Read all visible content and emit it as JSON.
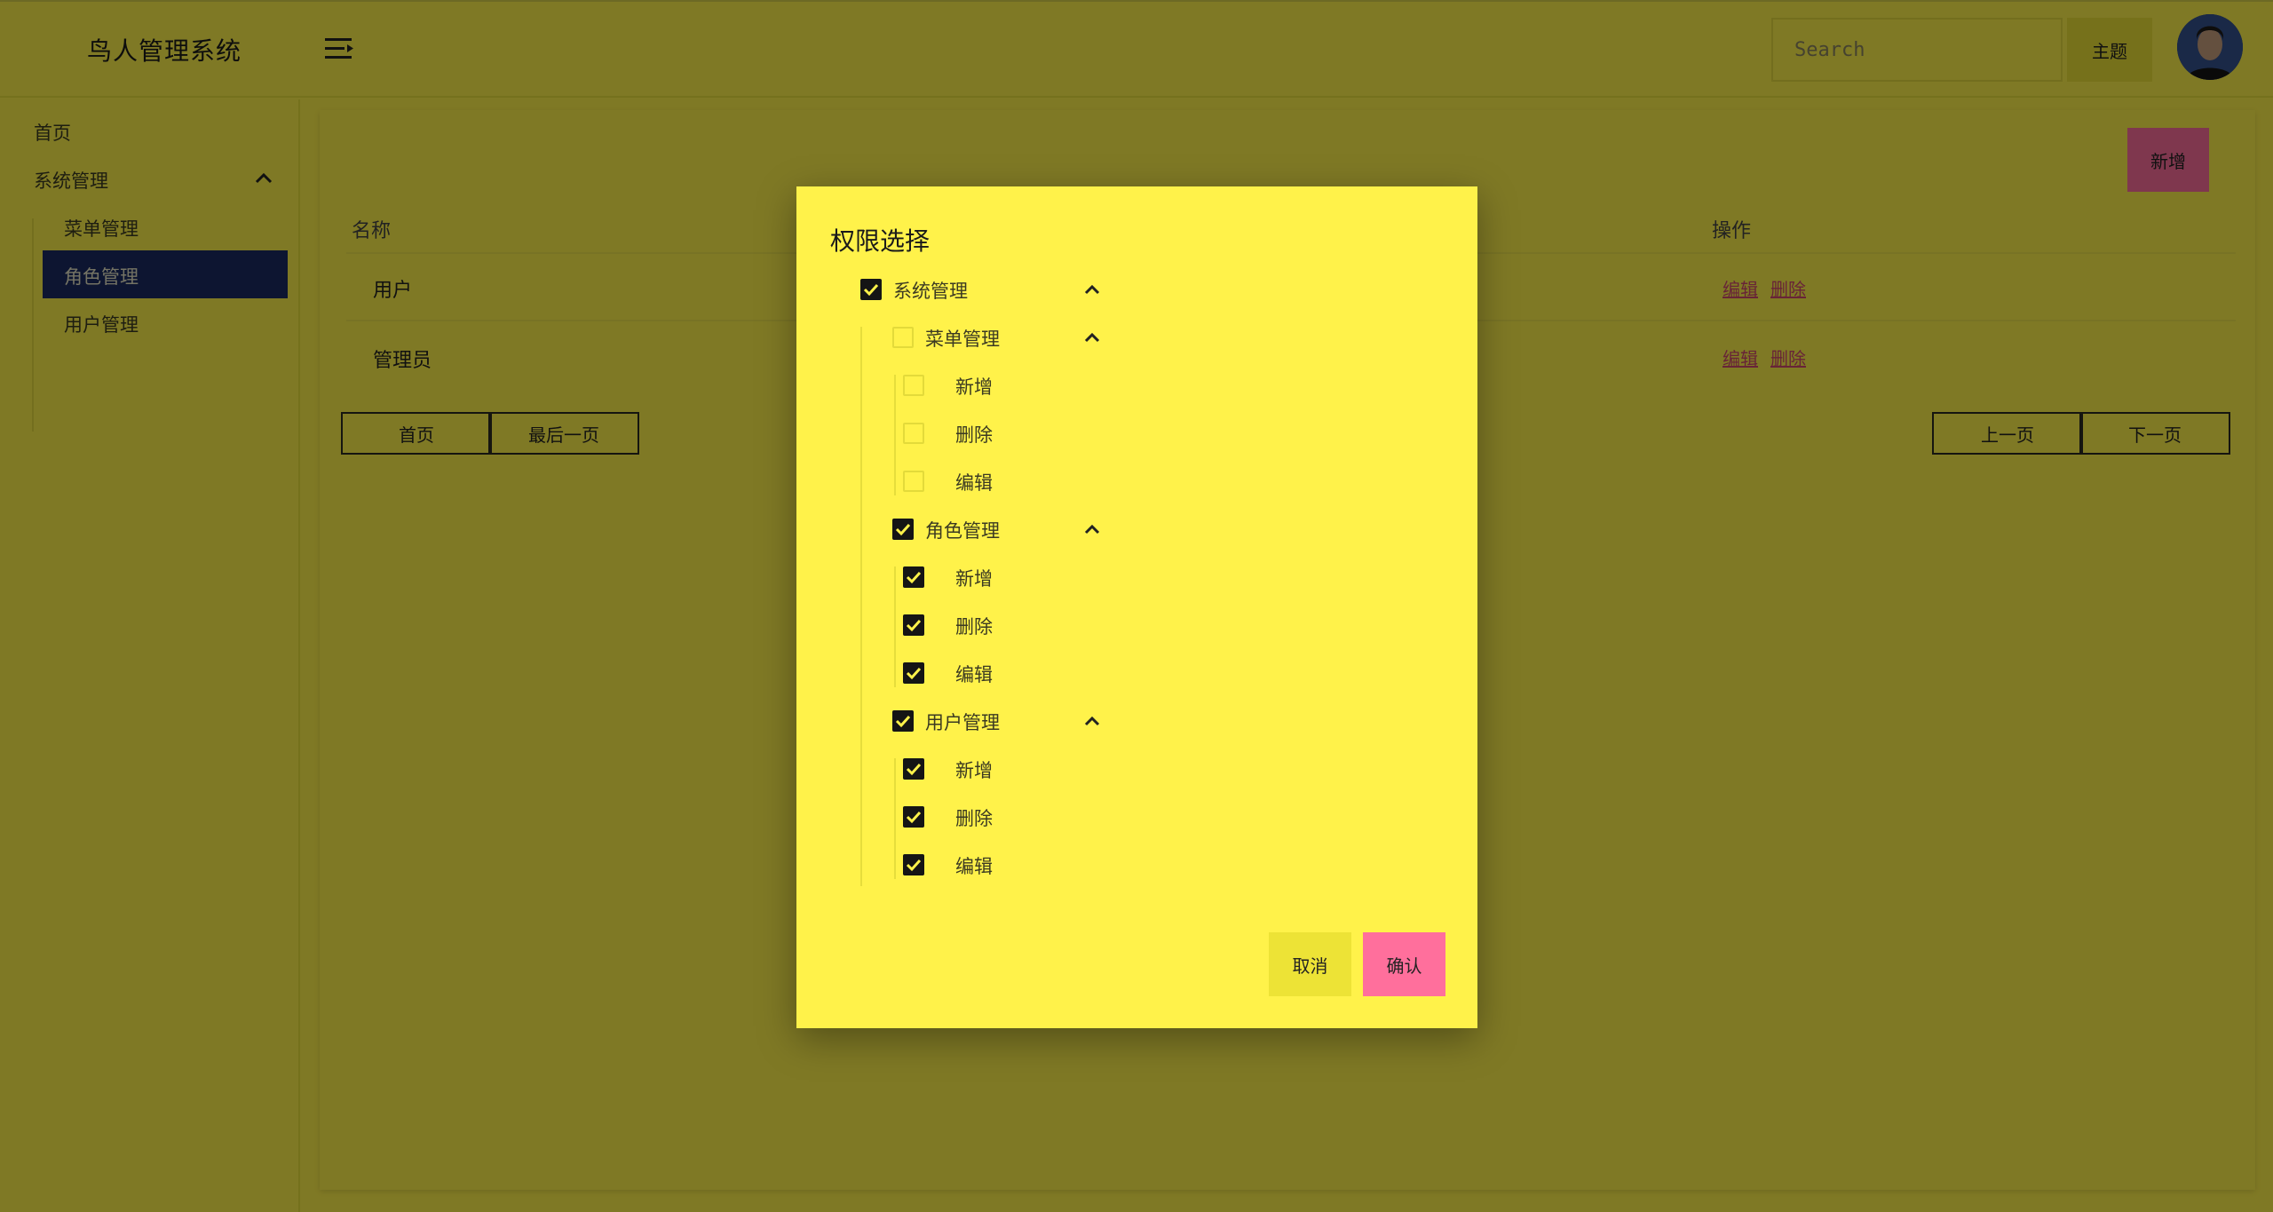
{
  "header": {
    "app_title": "鸟人管理系统",
    "search_placeholder": "Search",
    "theme_label": "主题"
  },
  "sidebar": {
    "items": [
      {
        "label": "首页"
      },
      {
        "label": "系统管理",
        "expanded": true,
        "children": [
          {
            "label": "菜单管理",
            "active": false
          },
          {
            "label": "角色管理",
            "active": true
          },
          {
            "label": "用户管理",
            "active": false
          }
        ]
      }
    ]
  },
  "main": {
    "add_label": "新增",
    "columns": [
      "名称",
      "操作"
    ],
    "rows": [
      {
        "name": "用户",
        "edit": "编辑",
        "delete": "删除"
      },
      {
        "name": "管理员",
        "edit": "编辑",
        "delete": "删除"
      }
    ],
    "pager": {
      "first": "首页",
      "last": "最后一页",
      "prev": "上一页",
      "next": "下一页"
    }
  },
  "modal": {
    "title": "权限选择",
    "tree": {
      "label": "系统管理",
      "checked": true,
      "expanded": true,
      "groups": [
        {
          "label": "菜单管理",
          "checked": false,
          "expanded": true,
          "actions": [
            {
              "label": "新增",
              "checked": false
            },
            {
              "label": "删除",
              "checked": false
            },
            {
              "label": "编辑",
              "checked": false
            }
          ]
        },
        {
          "label": "角色管理",
          "checked": true,
          "expanded": true,
          "actions": [
            {
              "label": "新增",
              "checked": true
            },
            {
              "label": "删除",
              "checked": true
            },
            {
              "label": "编辑",
              "checked": true
            }
          ]
        },
        {
          "label": "用户管理",
          "checked": true,
          "expanded": true,
          "actions": [
            {
              "label": "新增",
              "checked": true
            },
            {
              "label": "删除",
              "checked": true
            },
            {
              "label": "编辑",
              "checked": true
            }
          ]
        }
      ]
    },
    "cancel_label": "取消",
    "confirm_label": "确认"
  },
  "colors": {
    "background": "#fff24a",
    "active_nav": "#1b2a63",
    "primary_button": "#ff6f9c",
    "secondary_button": "#ede336",
    "checkbox_checked": "#151515"
  }
}
